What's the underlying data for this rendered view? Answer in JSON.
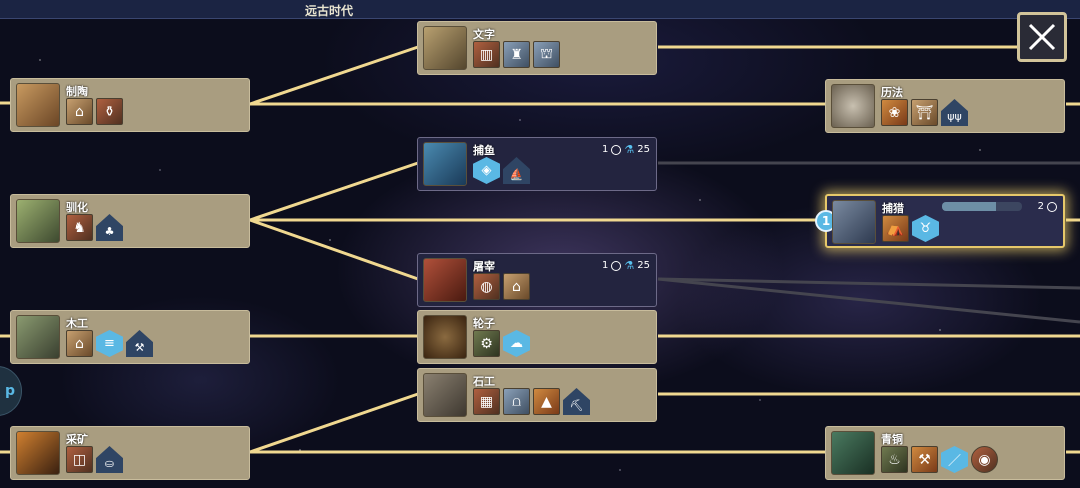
{
  "era": {
    "title": "远古时代"
  },
  "colors": {
    "link": "#f0d890",
    "link_dim": "#3a3a44",
    "accent": "#5ab8e4",
    "node_bg": "#a99d80",
    "node_dark": "#23243f",
    "active_glow": "#e6c86a"
  },
  "side_tab": {
    "label": "p"
  },
  "nodes": {
    "pottery": {
      "name": "制陶",
      "icons": [
        "pottery-icon",
        "granary-icon",
        "jars-icon"
      ]
    },
    "writing": {
      "name": "文字",
      "icons": [
        "library-icon",
        "monument-icon",
        "temple-icon"
      ]
    },
    "calendar": {
      "name": "历法",
      "icons": [
        "crops-icon",
        "pavilion-icon",
        "farm-improvement-icon"
      ]
    },
    "fishing": {
      "name": "捕鱼",
      "turns": "1",
      "science": "25",
      "icons": [
        "fish-resource-icon",
        "fishing-boat-icon"
      ]
    },
    "domestication": {
      "name": "驯化",
      "icons": [
        "horse-icon",
        "camel-icon",
        "pasture-icon"
      ]
    },
    "hunting": {
      "name": "捕猎",
      "turns": "2",
      "queue": "1",
      "progress_fraction": 0.68,
      "icons": [
        "tent-icon",
        "hunting-resource-icon"
      ]
    },
    "butchery": {
      "name": "屠宰",
      "turns": "1",
      "science": "25",
      "icons": [
        "meat-icon",
        "market-icon"
      ]
    },
    "carpentry": {
      "name": "木工",
      "icons": [
        "sawmill-icon",
        "lumber-icon",
        "woodcutter-icon"
      ]
    },
    "wheel": {
      "name": "轮子",
      "icons": [
        "cart-icon",
        "road-icon"
      ]
    },
    "masonry": {
      "name": "石工",
      "icons": [
        "walls-icon",
        "aqueduct-icon",
        "pyramid-icon",
        "quarry-icon"
      ]
    },
    "mining": {
      "name": "采矿",
      "icons": [
        "mine-resource-icon",
        "ore-cart-icon",
        "mine-improvement-icon"
      ]
    },
    "bronze": {
      "name": "青铜",
      "icons": [
        "forge-icon",
        "smithy-icon",
        "sword-icon",
        "bronze-shield-icon"
      ]
    }
  }
}
